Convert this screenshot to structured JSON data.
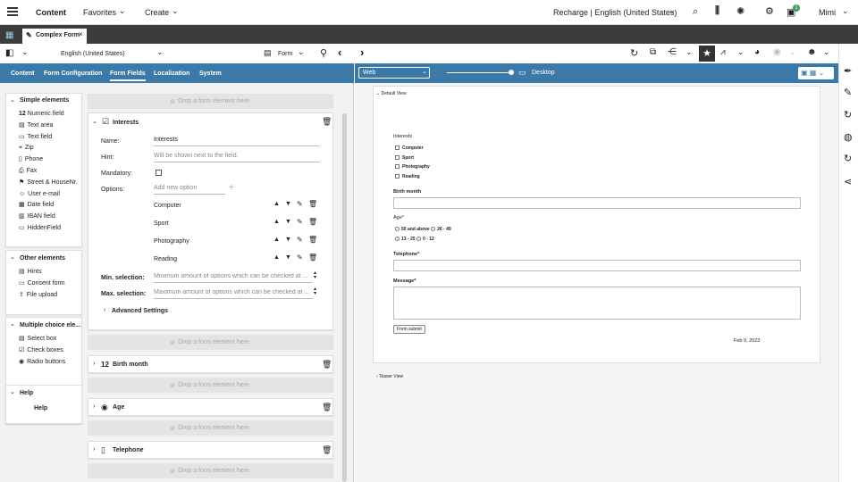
{
  "header": {
    "menu_label": "Content",
    "favorites": "Favorites",
    "create": "Create",
    "site": "Recharge | English (United States)",
    "user": "Mimi",
    "notification_count": "1"
  },
  "tab": {
    "title": "Complex Form"
  },
  "left_toolbar": {
    "locale": "English (United States)",
    "view": "Form"
  },
  "subtabs": [
    {
      "label": "Content"
    },
    {
      "label": "Form Configuration"
    },
    {
      "label": "Form Fields"
    },
    {
      "label": "Localization"
    },
    {
      "label": "System"
    }
  ],
  "palette": {
    "simple_title": "Simple elements",
    "simple": [
      "Numeric field",
      "Text area",
      "Text field",
      "Zip",
      "Phone",
      "Fax",
      "Street & HouseNr.",
      "User e-mail",
      "Date field",
      "IBAN field",
      "HiddenField"
    ],
    "other_title": "Other elements",
    "other": [
      "Hints",
      "Consent form",
      "File upload"
    ],
    "multi_title": "Multiple choice ele...",
    "multi": [
      "Select box",
      "Check boxes",
      "Radio buttons"
    ],
    "help_title": "Help",
    "help_item": "Help"
  },
  "drop_label": "Drop a form element here.",
  "interests": {
    "title": "Interests",
    "name_label": "Name:",
    "name_value": "Interests",
    "hint_label": "Hint:",
    "hint_value": "Will be shown next to the field.",
    "mandatory_label": "Mandatory:",
    "options_label": "Options:",
    "add_option_placeholder": "Add new option",
    "options": [
      "Computer",
      "Sport",
      "Photography",
      "Reading"
    ],
    "min_label": "Min. selection:",
    "min_placeholder": "Minimum amount of options which can be checked at ...",
    "max_label": "Max. selection:",
    "max_placeholder": "Maximum amount of options which can be checked at ...",
    "advanced": "Advanced Settings"
  },
  "collapsed": [
    {
      "title": "Birth month"
    },
    {
      "title": "Age"
    },
    {
      "title": "Telephone"
    }
  ],
  "preview_toolbar": {
    "channel": "Web",
    "device": "Desktop"
  },
  "preview": {
    "default_view": "Default View",
    "interests": "Interests",
    "options": [
      "Computer",
      "Sport",
      "Photography",
      "Reading"
    ],
    "birth_month": "Birth month",
    "age": "Age*",
    "age_options": [
      "50 and above",
      "26 - 49",
      "13 - 25",
      "0 - 12"
    ],
    "telephone": "Telephone*",
    "message": "Message*",
    "submit": "Form submit",
    "date": "Feb 9, 2023",
    "teaser_view": "Teaser View"
  }
}
